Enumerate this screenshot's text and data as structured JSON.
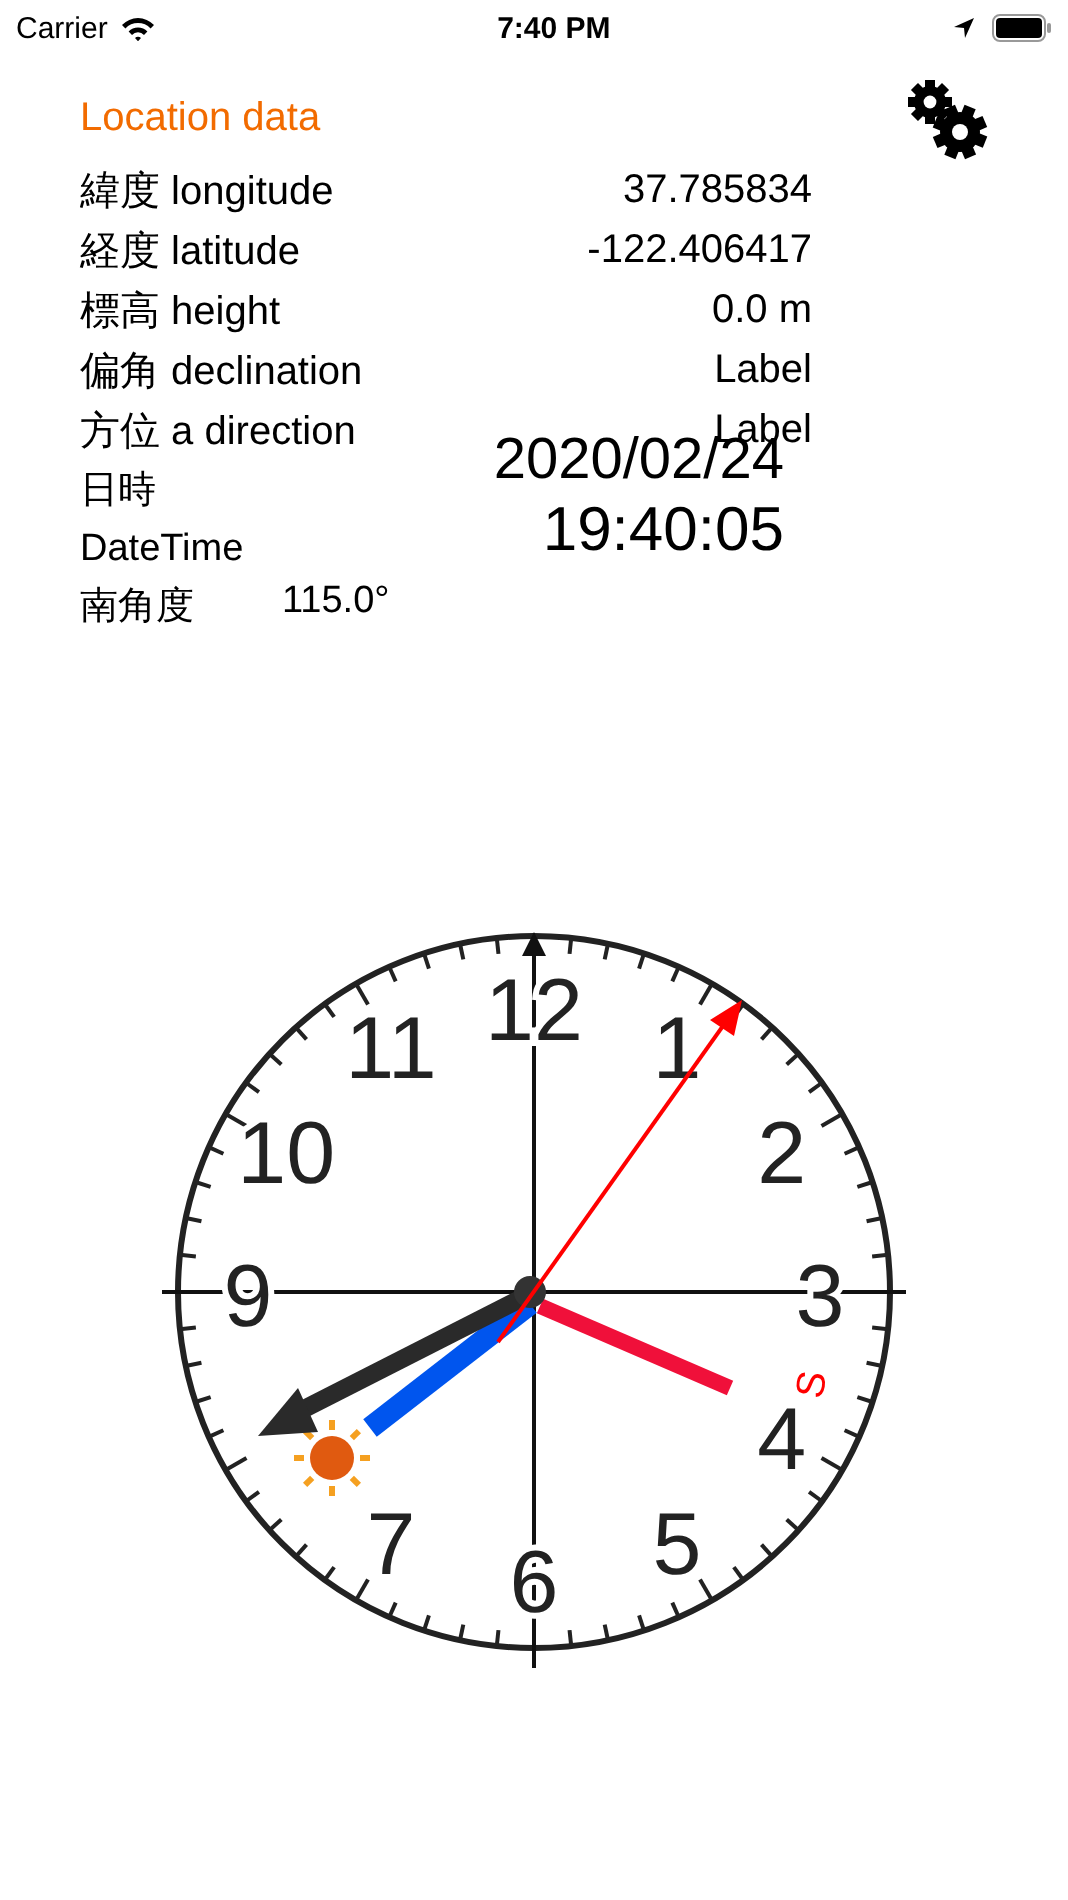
{
  "status_bar": {
    "carrier": "Carrier",
    "time": "7:40 PM"
  },
  "title": "Location data",
  "rows": [
    {
      "label": "緯度 longitude",
      "value": "37.785834"
    },
    {
      "label": "経度 latitude",
      "value": "-122.406417"
    },
    {
      "label": "標高 height",
      "value": "0.0 m"
    },
    {
      "label": "偏角 declination",
      "value": "Label"
    },
    {
      "label": "方位 a direction",
      "value": "Label"
    }
  ],
  "datetime": {
    "label_ja": "日時",
    "label_en": "DateTime",
    "date": "2020/02/24",
    "time": "19:40:05"
  },
  "south_angle": {
    "label": "南角度",
    "value": "115.0°"
  },
  "clock": {
    "numerals": [
      "12",
      "11",
      "1",
      "10",
      "2",
      "9",
      "3",
      "4",
      "7",
      "5",
      "6"
    ],
    "south_mark": "S"
  }
}
